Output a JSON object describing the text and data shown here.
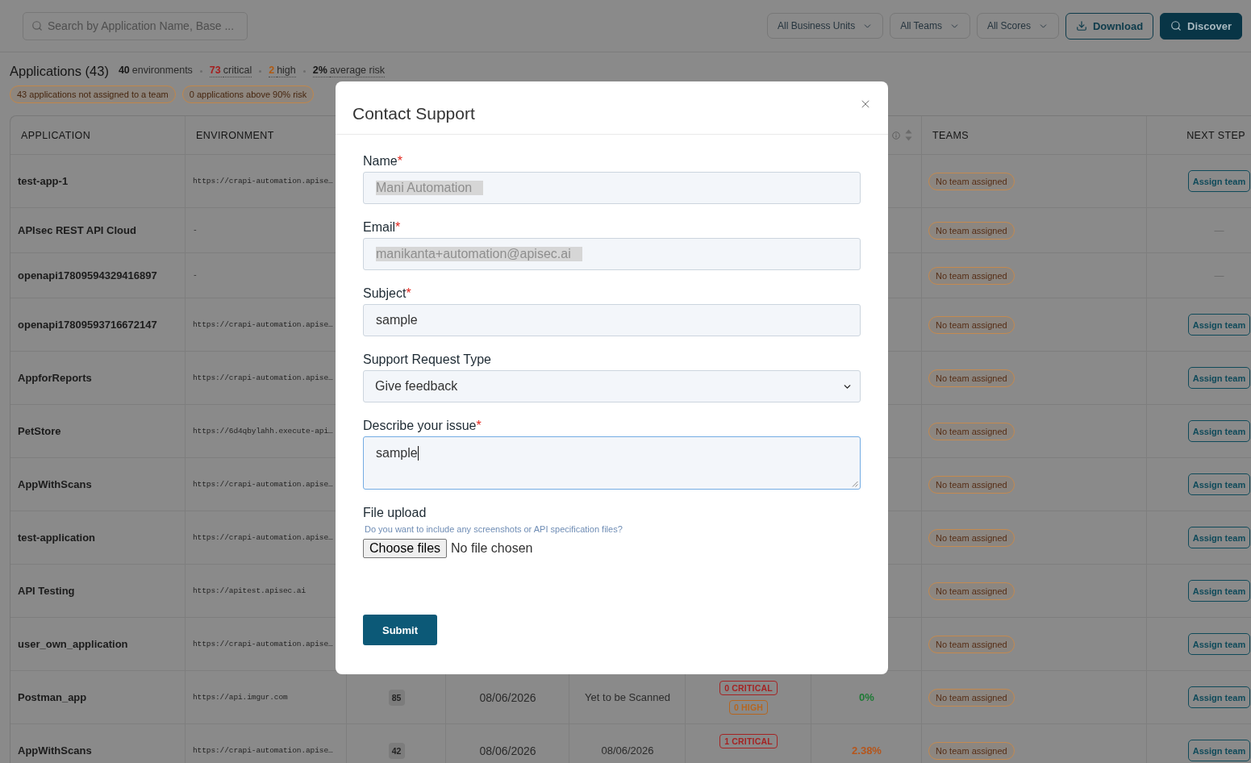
{
  "search": {
    "placeholder": "Search by Application Name, Base ..."
  },
  "filters": [
    {
      "label": "All Business Units"
    },
    {
      "label": "All Teams"
    },
    {
      "label": "All Scores"
    }
  ],
  "actions": [
    {
      "label": "Download",
      "kind": "outline"
    },
    {
      "label": "Discover",
      "kind": "primary"
    }
  ],
  "summary": {
    "title": "Applications (43)",
    "stats": [
      {
        "count": "40",
        "caption": "environments",
        "kind": "plain"
      },
      {
        "count": "73",
        "caption": "critical",
        "kind": "critical"
      },
      {
        "count": "2",
        "caption": "high",
        "kind": "high"
      },
      {
        "count": "2%",
        "caption": "average risk",
        "kind": "average"
      }
    ],
    "alerts": [
      "43 applications not assigned to a team",
      "0 applications above 90% risk"
    ]
  },
  "table": {
    "columns": [
      {
        "kind": "text",
        "label": "APPLICATION"
      },
      {
        "kind": "text",
        "label": "ENVIRONMENT"
      },
      {
        "kind": "blank"
      },
      {
        "kind": "blank"
      },
      {
        "kind": "blank"
      },
      {
        "kind": "blank"
      },
      {
        "kind": "icons"
      },
      {
        "kind": "text",
        "label": "TEAMS"
      },
      {
        "kind": "text",
        "label": "NEXT STEP"
      }
    ],
    "rows": [
      {
        "application": "test-app-1",
        "environment": "https://crapi-automation.apise…",
        "team": "No team assigned",
        "next_step": {
          "kind": "button",
          "label": "Assign team"
        }
      },
      {
        "application": "APIsec REST API Cloud",
        "environment": "-",
        "team": "No team assigned",
        "next_step": {
          "kind": "none",
          "label": "—"
        }
      },
      {
        "application": "openapi17809594329416897",
        "environment": "-",
        "team": "No team assigned",
        "next_step": {
          "kind": "none",
          "label": "—"
        }
      },
      {
        "application": "openapi17809593716672147",
        "environment": "https://crapi-automation.apise…",
        "team": "No team assigned",
        "next_step": {
          "kind": "button",
          "label": "Assign team"
        }
      },
      {
        "application": "AppforReports",
        "environment": "https://crapi-automation.apise…",
        "team": "No team assigned",
        "next_step": {
          "kind": "button",
          "label": "Assign team"
        }
      },
      {
        "application": "PetStore",
        "environment": "https://6d4qbylahh.execute-api…",
        "team": "No team assigned",
        "next_step": {
          "kind": "button",
          "label": "Assign team"
        }
      },
      {
        "application": "AppWithScans",
        "environment": "https://crapi-automation.apise…",
        "team": "No team assigned",
        "next_step": {
          "kind": "button",
          "label": "Assign team"
        }
      },
      {
        "application": "test-application",
        "environment": "https://crapi-automation.apise…",
        "team": "No team assigned",
        "next_step": {
          "kind": "button",
          "label": "Assign team"
        }
      },
      {
        "application": "API Testing",
        "environment": "https://apitest.apisec.ai",
        "team": "No team assigned",
        "next_step": {
          "kind": "button",
          "label": "Assign team"
        }
      },
      {
        "application": "user_own_application",
        "environment": "https://crapi-automation.apise…",
        "team": "No team assigned",
        "next_step": {
          "kind": "button",
          "label": "Assign team"
        }
      },
      {
        "application": "Postman_app",
        "environment": "https://api.imgur.com",
        "column_3": "85",
        "column_4": "08/06/2026",
        "column_5": "Yet to be Scanned",
        "column_6": [
          {
            "label": "0 CRITICAL",
            "kind": "critical"
          },
          {
            "label": "0 HIGH",
            "kind": "high"
          }
        ],
        "column_7": {
          "text": "0%",
          "color": "#1f7a36"
        },
        "team": "No team assigned",
        "next_step": {
          "kind": "button",
          "label": "Assign team"
        }
      },
      {
        "application": "AppWithScans",
        "environment": "https://crapi-automation.apise…",
        "column_3": "42",
        "column_4": "08/06/2026",
        "column_5": "08/06/2026",
        "column_6": [
          {
            "label": "1 CRITICAL",
            "kind": "critical"
          }
        ],
        "column_7": {
          "text": "2.38%",
          "color": "#b5561c"
        },
        "team": "No team assigned",
        "next_step": {
          "kind": "button",
          "label": "Assign team"
        }
      }
    ]
  },
  "dialog": {
    "title": "Contact Support",
    "fields": [
      {
        "kind": "text",
        "label": "Name",
        "required_mark": "*",
        "value": "Mani Automation",
        "disabled": true,
        "focused": false
      },
      {
        "kind": "text",
        "label": "Email",
        "required_mark": "*",
        "value": "manikanta+automation@apisec.ai",
        "disabled": true,
        "focused": false
      },
      {
        "kind": "text",
        "label": "Subject",
        "required_mark": "*",
        "value": "sample",
        "disabled": false,
        "focused": false
      },
      {
        "kind": "select",
        "label": "Support Request Type",
        "value": "Give feedback",
        "disabled": false,
        "focused": false
      },
      {
        "kind": "textarea",
        "label": "Describe your issue",
        "required_mark": "*",
        "value": "sample",
        "disabled": false,
        "focused": true
      },
      {
        "kind": "file",
        "label": "File upload",
        "hint": "Do you want to include any screenshots or API specification files?",
        "button": "Choose files",
        "status": "No file chosen",
        "disabled": false,
        "focused": false
      }
    ],
    "submit": "Submit"
  }
}
